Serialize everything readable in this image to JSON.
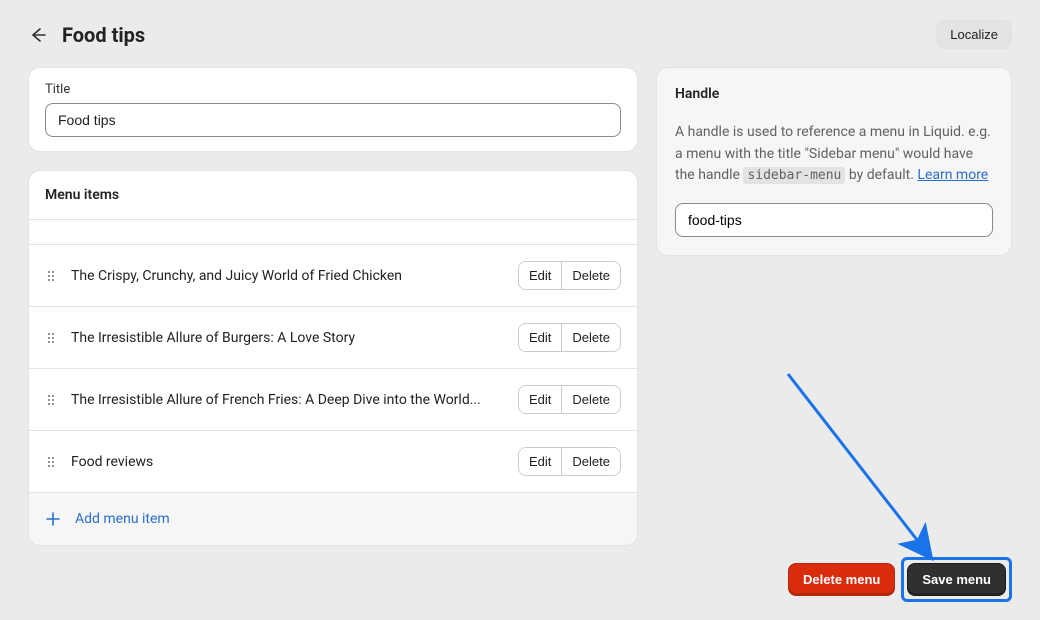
{
  "header": {
    "title": "Food tips",
    "localize_label": "Localize"
  },
  "title_card": {
    "label": "Title",
    "value": "Food tips"
  },
  "menu": {
    "heading": "Menu items",
    "edit_label": "Edit",
    "delete_label": "Delete",
    "add_label": "Add menu item",
    "items": [
      {
        "label": "The Crispy, Crunchy, and Juicy World of Fried Chicken"
      },
      {
        "label": "The Irresistible Allure of Burgers: A Love Story"
      },
      {
        "label": "The Irresistible Allure of French Fries: A Deep Dive into the World..."
      },
      {
        "label": "Food reviews"
      }
    ]
  },
  "handle": {
    "heading": "Handle",
    "desc_pre": "A handle is used to reference a menu in Liquid. e.g. a menu with the title \"Sidebar menu\" would have the handle ",
    "code": "sidebar-menu",
    "desc_post": " by default. ",
    "learn_more": "Learn more",
    "value": "food-tips"
  },
  "footer": {
    "delete_label": "Delete menu",
    "save_label": "Save menu"
  }
}
